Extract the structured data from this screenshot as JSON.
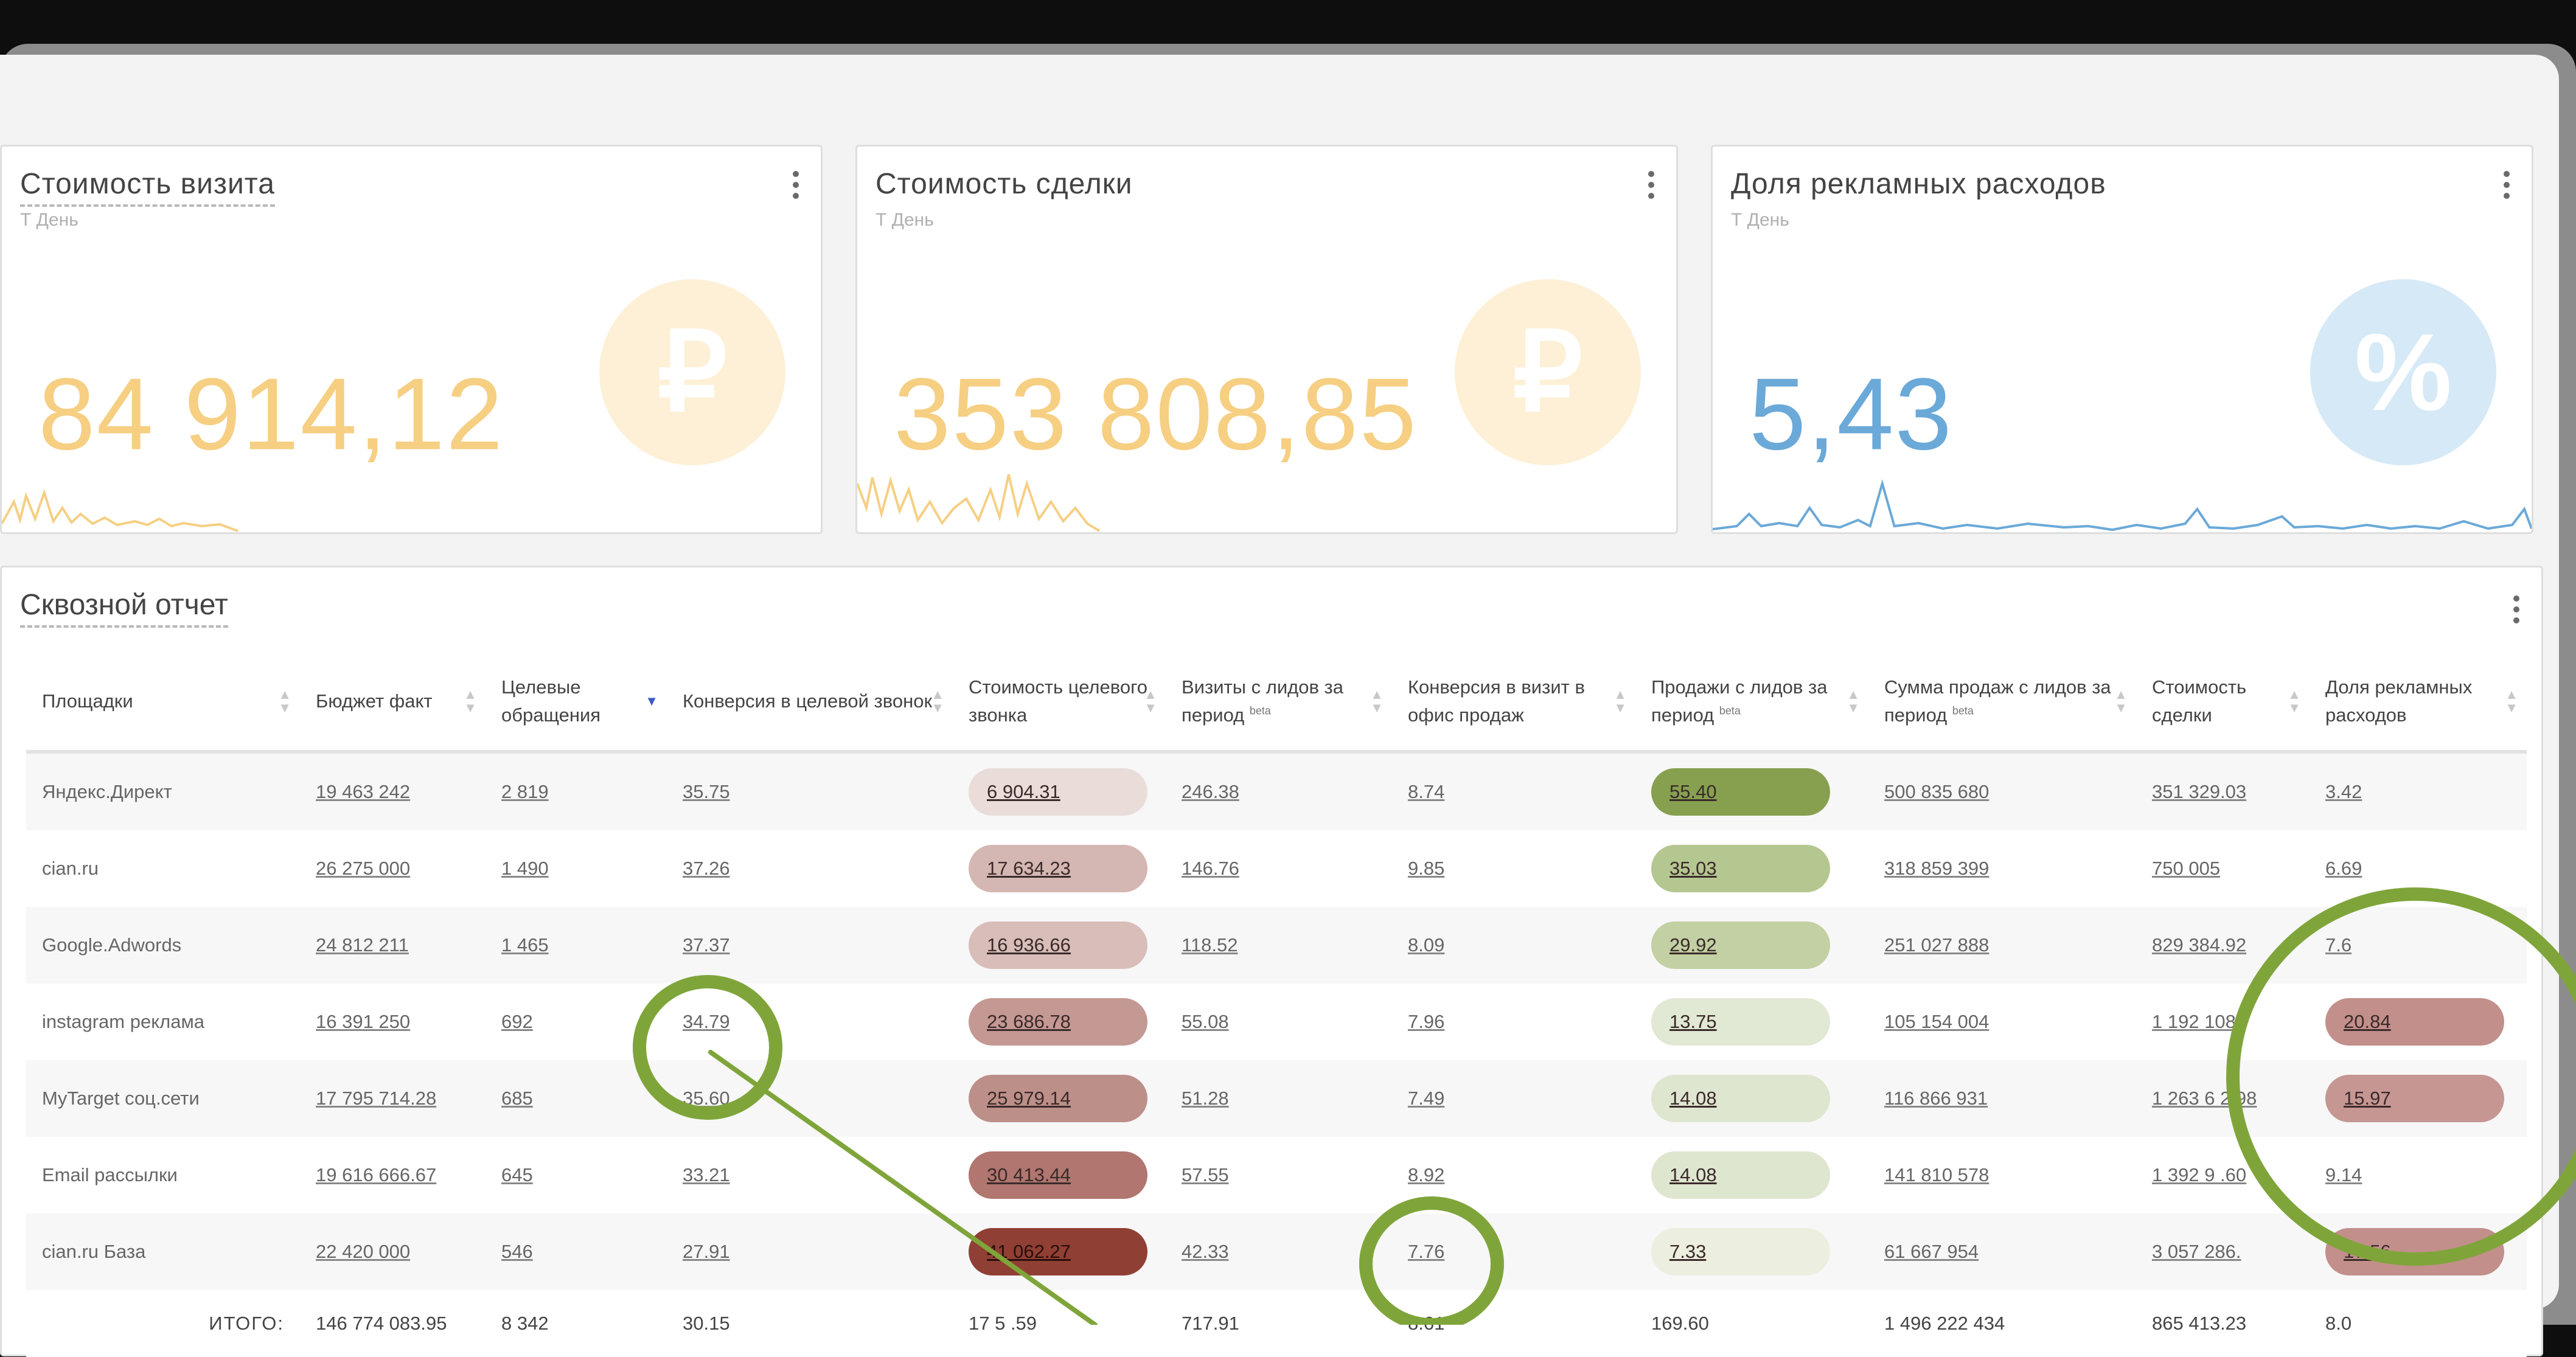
{
  "colors": {
    "gold": "#f6cf83",
    "gold_circle": "#fdf0d6",
    "blue": "#6ba9d8",
    "blue_circle": "#d6e9f6",
    "annotation": "#7fa53a"
  },
  "cards": [
    {
      "title": "Стоимость визита",
      "filter": "Т День ",
      "value": "84 914,12",
      "icon": "ruble-sign",
      "icon_glyph": "₽",
      "value_color": "#f6cf83",
      "circle_color": "#fdf0d6"
    },
    {
      "title": "Стоимость сделки",
      "filter": "Т День ",
      "value": "353 808,85",
      "icon": "ruble-sign",
      "icon_glyph": "₽",
      "value_color": "#f6cf83",
      "circle_color": "#fdf0d6"
    },
    {
      "title": "Доля рекламных расходов",
      "filter": "Т День ",
      "value": "5,43",
      "icon": "percent-sign",
      "icon_glyph": "%",
      "value_color": "#6ba9d8",
      "circle_color": "#d6e9f6"
    }
  ],
  "report": {
    "title": "Сквозной отчет",
    "columns": [
      {
        "label": "Площадки",
        "sup": ""
      },
      {
        "label": "Бюджет факт",
        "sup": ""
      },
      {
        "label": "Целевые обращения",
        "sup": "",
        "sorted": true
      },
      {
        "label": "Конверсия в целевой звонок",
        "sup": ""
      },
      {
        "label": "Стоимость целевого звонка",
        "sup": ""
      },
      {
        "label": "Визиты с лидов за период",
        "sup": "beta"
      },
      {
        "label": "Конверсия в визит в офис продаж",
        "sup": ""
      },
      {
        "label": "Продажи с лидов за период",
        "sup": "beta"
      },
      {
        "label": "Сумма продаж с лидов за период",
        "sup": "beta"
      },
      {
        "label": "Стоимость сделки",
        "sup": ""
      },
      {
        "label": "Доля рекламных расходов",
        "sup": ""
      }
    ],
    "rows": [
      {
        "site": "Яндекс.Директ",
        "budget": "19 463 242",
        "leads": "2 819",
        "conv_call": "35.75",
        "call_cost": "6 904.31",
        "call_cost_color": "#e9dcd9",
        "visits": "246.38",
        "conv_visit": "8.74",
        "sales": "55.40",
        "sales_color": "#86a050",
        "revenue": "500 835 680",
        "deal_cost": "351 329.03",
        "ad_share": "3.42",
        "ad_share_color": ""
      },
      {
        "site": "cian.ru",
        "budget": "26 275 000",
        "leads": "1 490",
        "conv_call": "37.26",
        "call_cost": "17 634.23",
        "call_cost_color": "#d4b7b2",
        "visits": "146.76",
        "conv_visit": "9.85",
        "sales": "35.03",
        "sales_color": "#b5c791",
        "revenue": "318 859 399",
        "deal_cost": "750 005",
        "ad_share": "6.69",
        "ad_share_color": ""
      },
      {
        "site": "Google.Adwords",
        "budget": "24 812 211",
        "leads": "1 465",
        "conv_call": "37.37",
        "call_cost": "16 936.66",
        "call_cost_color": "#d8bdb9",
        "visits": "118.52",
        "conv_visit": "8.09",
        "sales": "29.92",
        "sales_color": "#c2d0a3",
        "revenue": "251 027 888",
        "deal_cost": "829 384.92",
        "ad_share": "7.6",
        "ad_share_color": ""
      },
      {
        "site": "instagram реклама",
        "budget": "16 391 250",
        "leads": "692",
        "conv_call": "34.79",
        "call_cost": "23 686.78",
        "call_cost_color": "#c49893",
        "visits": "55.08",
        "conv_visit": "7.96",
        "sales": "13.75",
        "sales_color": "#e1e8d3",
        "revenue": "105 154 004",
        "deal_cost": "1 192 108.",
        "ad_share": "20.84",
        "ad_share_color": "#c28f8b"
      },
      {
        "site": "MyTarget соц.сети",
        "budget": "17 795 714.28",
        "leads": "685",
        "conv_call": "35.60",
        "call_cost": "25 979.14",
        "call_cost_color": "#bd8f89",
        "visits": "51.28",
        "conv_visit": "7.49",
        "sales": "14.08",
        "sales_color": "#dfe6d0",
        "revenue": "116 866 931",
        "deal_cost": "1 263 6 2.98",
        "ad_share": "15.97",
        "ad_share_color": "#c69692"
      },
      {
        "site": "Email рассылки",
        "budget": "19 616 666.67",
        "leads": "645",
        "conv_call": "33.21",
        "call_cost": "30 413.44",
        "call_cost_color": "#b0766f",
        "visits": "57.55",
        "conv_visit": "8.92",
        "sales": "14.08",
        "sales_color": "#dfe6d0",
        "revenue": "141 810 578",
        "deal_cost": "1 392 9 .60",
        "ad_share": "9.14",
        "ad_share_color": ""
      },
      {
        "site": "cian.ru База",
        "budget": "22 420 000",
        "leads": "546",
        "conv_call": "27.91",
        "call_cost": "41 062.27",
        "call_cost_color": "#8f3f33",
        "visits": "42.33",
        "conv_visit": "7.76",
        "sales": "7.33",
        "sales_color": "#eceedf",
        "revenue": "61 667 954",
        "deal_cost": "3 057 286.",
        "ad_share": "17.56",
        "ad_share_color": "#c28f8b"
      }
    ],
    "total": {
      "label": "ИТОГО:",
      "budget": "146 774 083.95",
      "leads": "8 342",
      "conv_call": "30.15",
      "call_cost": "17 5 .59",
      "visits": "717.91",
      "conv_visit": "8.61",
      "sales": "169.60",
      "revenue": "1 496 222 434",
      "deal_cost": "865 413.23",
      "ad_share": "8.0"
    }
  }
}
